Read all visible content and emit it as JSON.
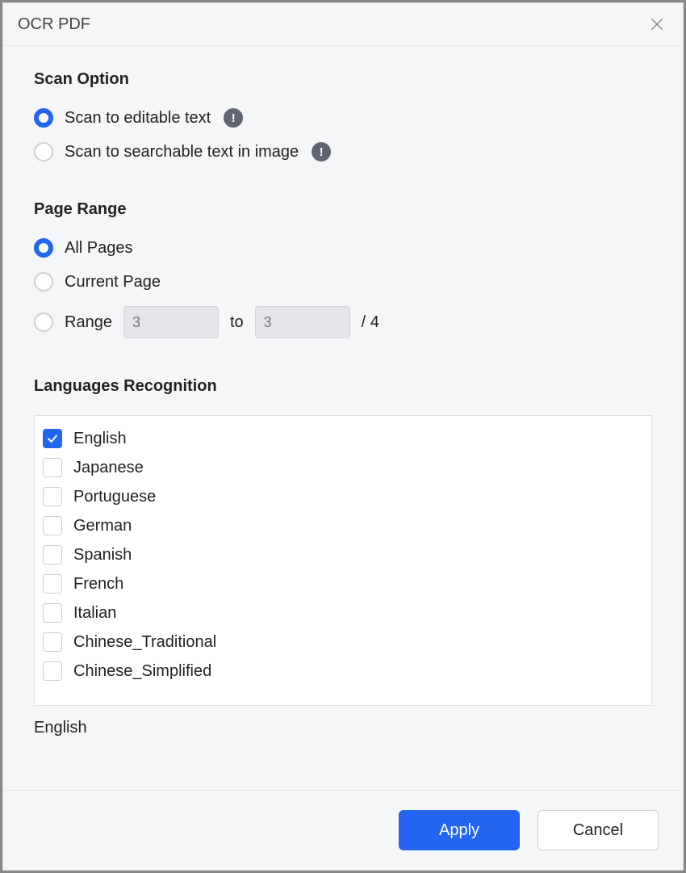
{
  "title": "OCR PDF",
  "scanOption": {
    "heading": "Scan Option",
    "options": [
      {
        "label": "Scan to editable text",
        "selected": true,
        "hasInfo": true
      },
      {
        "label": "Scan to searchable text in image",
        "selected": false,
        "hasInfo": true
      }
    ],
    "infoGlyph": "!"
  },
  "pageRange": {
    "heading": "Page Range",
    "options": [
      {
        "label": "All Pages",
        "selected": true
      },
      {
        "label": "Current Page",
        "selected": false
      }
    ],
    "rangeLabel": "Range",
    "rangeFromPlaceholder": "3",
    "rangeToLabel": "to",
    "rangeToPlaceholder": "3",
    "totalPrefix": "/",
    "totalPages": "4"
  },
  "languages": {
    "heading": "Languages Recognition",
    "items": [
      {
        "label": "English",
        "checked": true
      },
      {
        "label": "Japanese",
        "checked": false
      },
      {
        "label": "Portuguese",
        "checked": false
      },
      {
        "label": "German",
        "checked": false
      },
      {
        "label": "Spanish",
        "checked": false
      },
      {
        "label": "French",
        "checked": false
      },
      {
        "label": "Italian",
        "checked": false
      },
      {
        "label": "Chinese_Traditional",
        "checked": false
      },
      {
        "label": "Chinese_Simplified",
        "checked": false
      }
    ],
    "selectedSummary": "English"
  },
  "footer": {
    "apply": "Apply",
    "cancel": "Cancel"
  }
}
